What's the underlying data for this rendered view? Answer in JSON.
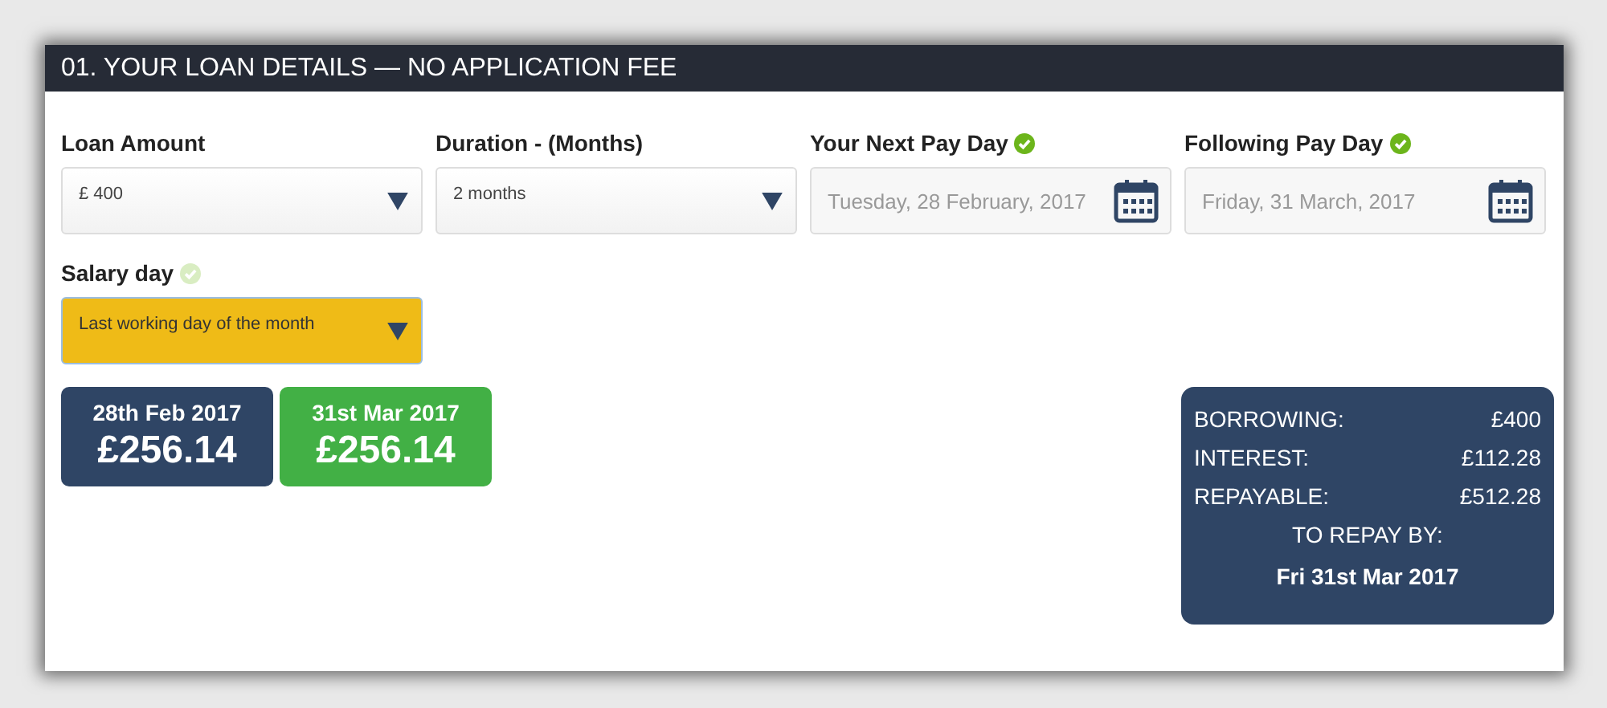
{
  "header": {
    "title": "01. YOUR LOAN DETAILS — NO APPLICATION FEE"
  },
  "fields": [
    {
      "label": "Loan Amount",
      "kind": "select",
      "value": "£ 400",
      "highlighted": false
    },
    {
      "label": "Duration - (Months)",
      "kind": "select",
      "value": "2 months",
      "highlighted": false
    },
    {
      "label": "Your Next Pay Day",
      "kind": "date",
      "placeholder": "Tuesday, 28 February, 2017",
      "validated": true,
      "highlighted": false
    },
    {
      "label": "Following Pay Day",
      "kind": "date",
      "placeholder": "Friday, 31 March, 2017",
      "validated": true,
      "highlighted": false
    },
    {
      "label": "Salary day",
      "kind": "select",
      "value": "Last working day of the month",
      "validated": false,
      "highlighted": true
    }
  ],
  "payments": [
    {
      "date": "28th Feb 2017",
      "amount": "£256.14",
      "color": "#2f4565"
    },
    {
      "date": "31st Mar 2017",
      "amount": "£256.14",
      "color": "#42b045"
    }
  ],
  "summary": {
    "rows": [
      {
        "label": "BORROWING:",
        "value": "£400"
      },
      {
        "label": "INTEREST:",
        "value": "£112.28"
      },
      {
        "label": "REPAYABLE:",
        "value": "£512.28"
      }
    ],
    "repay_label": "TO REPAY BY:",
    "repay_date": "Fri 31st Mar 2017"
  }
}
